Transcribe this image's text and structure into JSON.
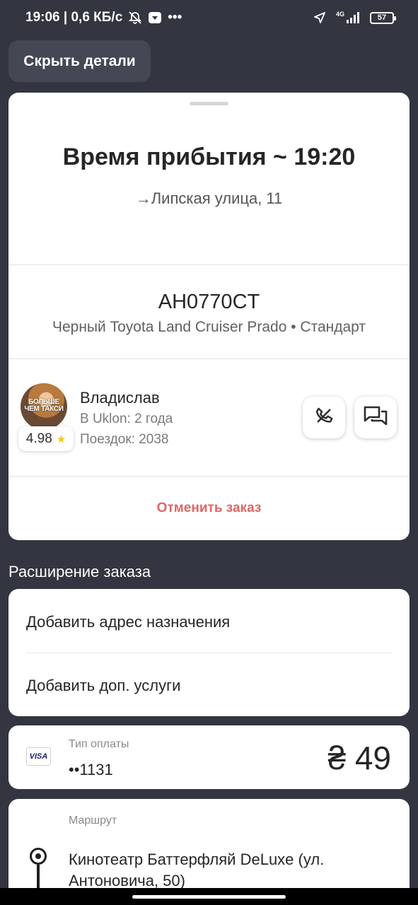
{
  "status": {
    "time_speed": "19:06 | 0,6 КБ/с",
    "more": "•••",
    "network": "4G",
    "battery": "57"
  },
  "hide_details_label": "Скрыть детали",
  "arrival": {
    "title": "Время прибытия ~ 19:20",
    "address": "→Липская улица, 11"
  },
  "car": {
    "plate": "AH0770CT",
    "description": "Черный Toyota Land Cruiser Prado • Стандарт"
  },
  "driver": {
    "avatar_text_1": "БОЛЬШЕ",
    "avatar_text_2": "ЧЕМ ТАКСИ",
    "rating": "4.98",
    "name": "Владислав",
    "years": "В Uklon: 2 года",
    "trips": "Поездок: 2038"
  },
  "cancel_label": "Отменить заказ",
  "extension": {
    "title": "Расширение заказа",
    "add_destination": "Добавить адрес назначения",
    "add_services": "Добавить доп. услуги"
  },
  "payment": {
    "card_brand": "VISA",
    "label": "Тип оплаты",
    "card_number": "••1131",
    "price": "₴ 49"
  },
  "route": {
    "label": "Маршрут",
    "from": "Кинотеатр Баттерфляй DeLuxe (ул. Антоновича, 50)"
  },
  "colors": {
    "background": "#333640",
    "cancel": "#e06666",
    "star": "#f5c518"
  }
}
